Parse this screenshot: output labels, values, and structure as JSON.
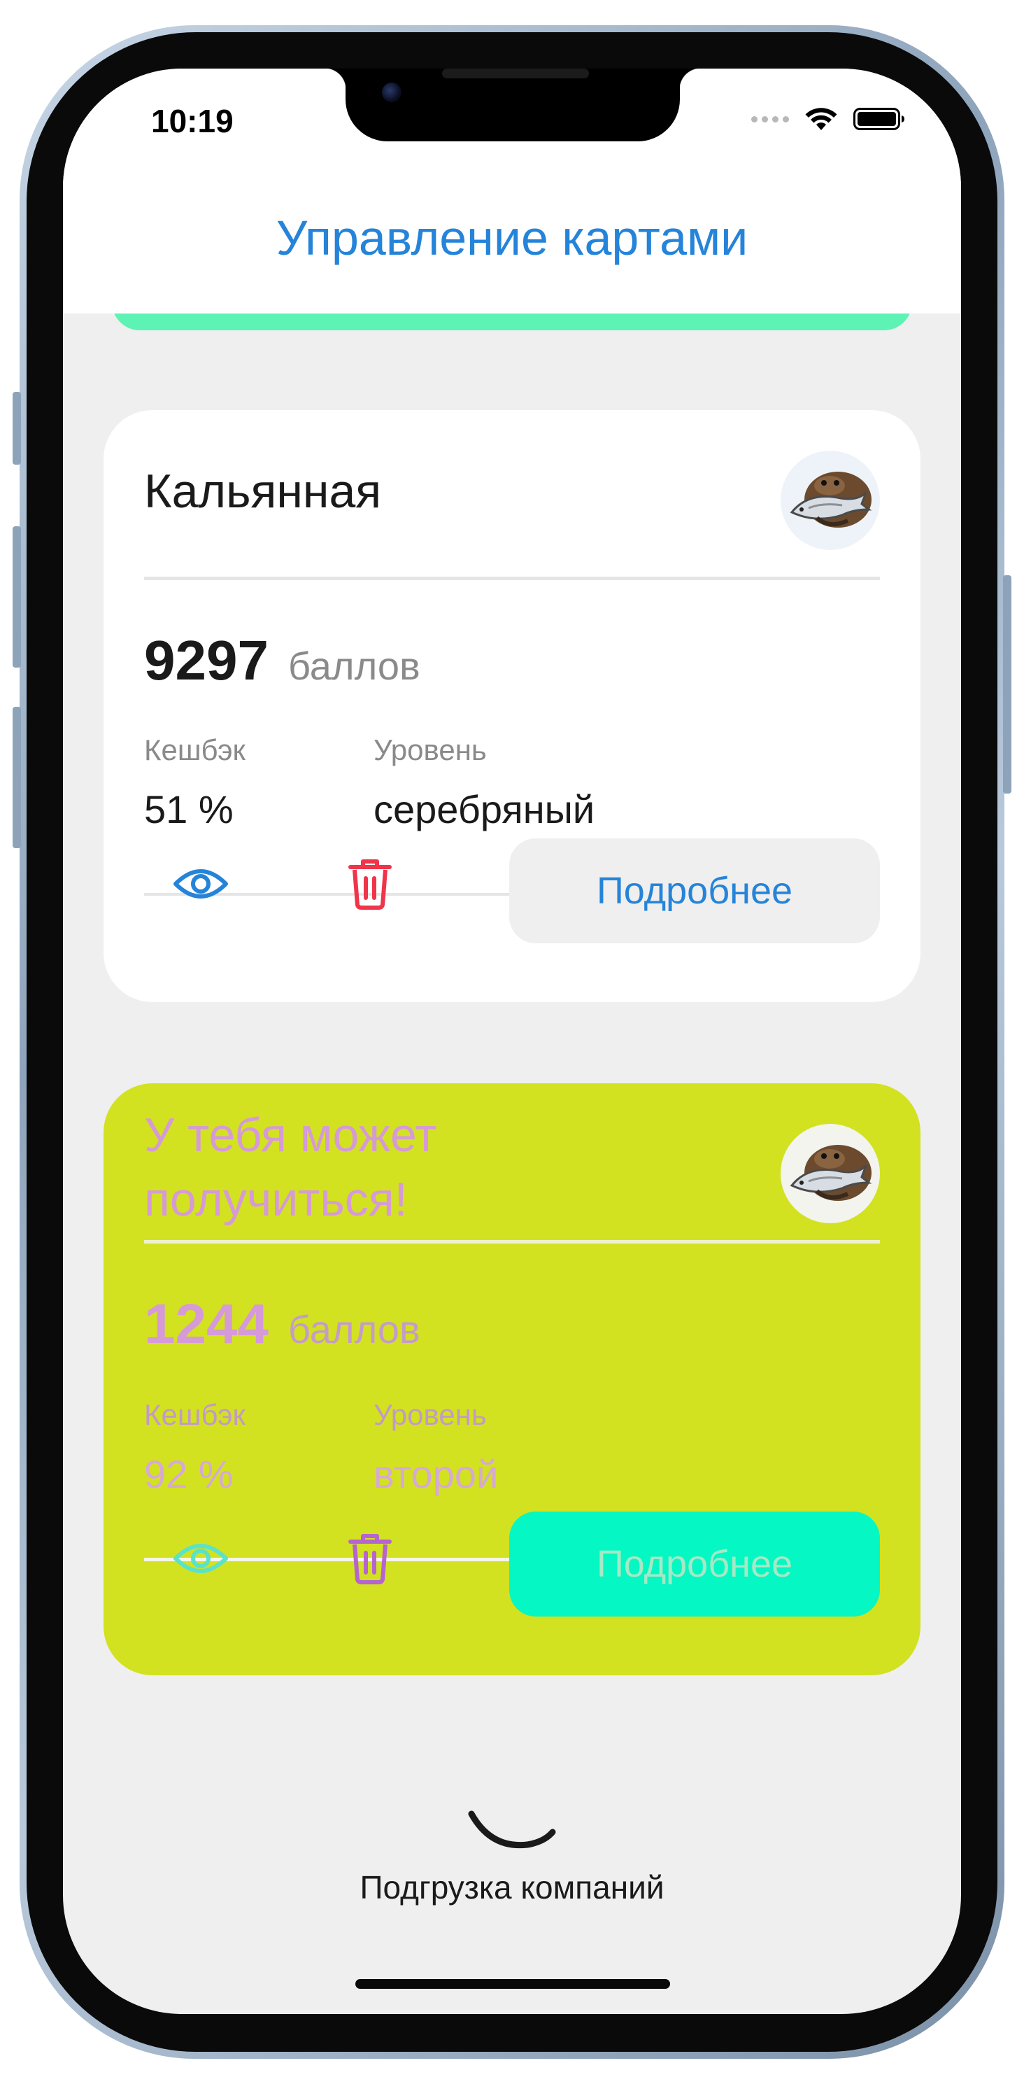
{
  "status_bar": {
    "time": "10:19"
  },
  "header": {
    "title": "Управление картами"
  },
  "cards": [
    {
      "title": "Кальянная",
      "points": "9297",
      "points_label": "баллов",
      "cashback_label": "Кешбэк",
      "cashback_value": "51 %",
      "level_label": "Уровень",
      "level_value": "серебряный",
      "more_label": "Подробнее",
      "colors": {
        "background": "#ffffff",
        "eye": "#2584d9",
        "trash": "#f0344a",
        "button_bg": "#efefef",
        "button_text": "#2584d9"
      }
    },
    {
      "title": "У тебя может получиться!",
      "points": "1244",
      "points_label": "баллов",
      "cashback_label": "Кешбэк",
      "cashback_value": "92 %",
      "level_label": "Уровень",
      "level_value": "второй",
      "more_label": "Подробнее",
      "colors": {
        "background": "#d2e221",
        "eye": "#5ae3c9",
        "trash": "#b564d0",
        "button_bg": "#05f7c3",
        "button_text": "#a5e9c5"
      }
    }
  ],
  "loader": {
    "text": "Подгрузка компаний"
  },
  "accent_colors": {
    "title": "#2584d9",
    "peek_card": "#5cf3b4"
  },
  "icons": [
    "wifi-icon",
    "battery-icon",
    "eye-icon",
    "trash-icon",
    "company-logo",
    "loading-spinner"
  ]
}
